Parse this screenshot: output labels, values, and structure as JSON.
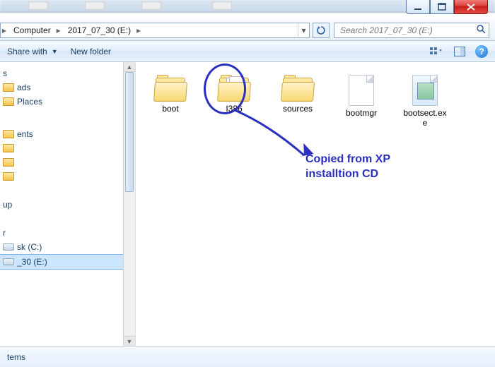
{
  "window": {
    "caption_buttons": {
      "minimize": "minimize",
      "maximize": "maximize",
      "close": "close"
    }
  },
  "breadcrumb": {
    "segments": [
      "Computer",
      "2017_07_30 (E:)"
    ]
  },
  "search": {
    "placeholder": "Search 2017_07_30 (E:)"
  },
  "commandbar": {
    "share_label": "Share with",
    "newfolder_label": "New folder"
  },
  "nav": {
    "items": [
      {
        "label": "s"
      },
      {
        "label": "ads"
      },
      {
        "label": "Places"
      },
      {
        "spacer": true
      },
      {
        "label": ""
      },
      {
        "label": "ents"
      },
      {
        "label": ""
      },
      {
        "label": ""
      },
      {
        "label": ""
      },
      {
        "spacer": true
      },
      {
        "label": "up"
      },
      {
        "spacer": true
      },
      {
        "label": "r"
      },
      {
        "label": "sk (C:)",
        "icon": "drive"
      },
      {
        "label": "_30 (E:)",
        "icon": "drive",
        "selected": true
      }
    ]
  },
  "files": [
    {
      "name": "boot",
      "type": "folder"
    },
    {
      "name": "I386",
      "type": "folder-open"
    },
    {
      "name": "sources",
      "type": "folder"
    },
    {
      "name": "bootmgr",
      "type": "file"
    },
    {
      "name": "bootsect.exe",
      "type": "exe"
    }
  ],
  "annotation": {
    "line1": "Copied from XP",
    "line2": "installtion CD"
  },
  "statusbar": {
    "text": "tems"
  },
  "icons": {
    "view": "view-icon",
    "preview": "preview-pane-icon",
    "help": "?"
  }
}
